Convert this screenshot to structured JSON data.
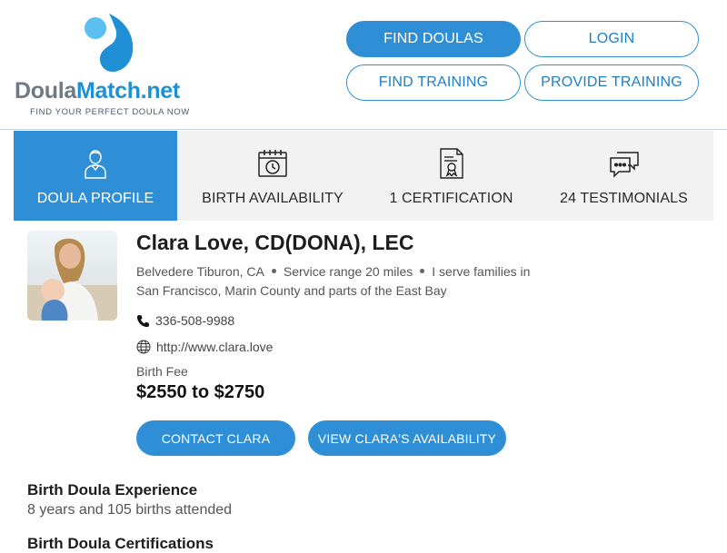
{
  "logo": {
    "text_part1": "Doula",
    "text_part2": "Match.net",
    "tagline": "FIND YOUR PERFECT DOULA NOW"
  },
  "nav": {
    "find_doulas": "FIND DOULAS",
    "login": "LOGIN",
    "find_training": "FIND TRAINING",
    "provide_training": "PROVIDE TRAINING"
  },
  "tabs": [
    {
      "label": "DOULA PROFILE",
      "icon": "doula-person-icon",
      "active": true
    },
    {
      "label": "BIRTH AVAILABILITY",
      "icon": "calendar-clock-icon",
      "active": false
    },
    {
      "label": "1 CERTIFICATION",
      "icon": "certificate-icon",
      "active": false
    },
    {
      "label": "24 TESTIMONIALS",
      "icon": "chat-bubbles-icon",
      "active": false
    }
  ],
  "profile": {
    "name": "Clara Love, CD(DONA), LEC",
    "location": "Belvedere Tiburon, CA",
    "service_range": "Service range 20 miles",
    "serve_line1": "I serve families in",
    "serve_line2": "San Francisco, Marin County and parts of the East Bay",
    "phone": "336-508-9988",
    "website": "http://www.clara.love",
    "fee_label": "Birth Fee",
    "fee": "$2550 to $2750",
    "contact_button": "CONTACT CLARA",
    "availability_button": "VIEW CLARA'S AVAILABILITY"
  },
  "sections": {
    "experience_title": "Birth Doula Experience",
    "experience_text": "8 years and 105 births attended",
    "certifications_title": "Birth Doula Certifications"
  },
  "colors": {
    "accent": "#2f8fd6",
    "tab_bg": "#f2f2f2"
  }
}
